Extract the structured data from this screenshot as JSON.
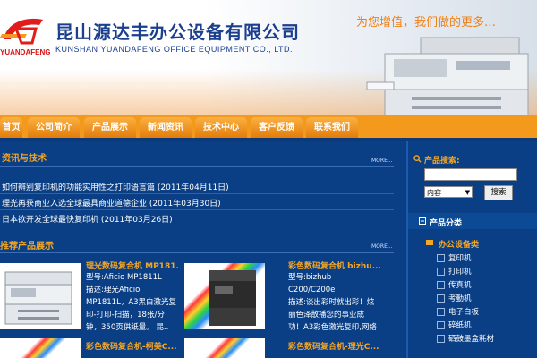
{
  "header": {
    "logo_text": "YUANDAFENG",
    "company_cn": "昆山源达丰办公设备有限公司",
    "company_en": "KUNSHAN YUANDAFENG OFFICE EQUIPMENT CO., LTD.",
    "slogan": "为您增值，我们做的更多…"
  },
  "nav": {
    "items": [
      "首页",
      "公司简介",
      "产品展示",
      "新闻资讯",
      "技术中心",
      "客户反馈",
      "联系我们"
    ]
  },
  "news": {
    "title": "资讯与技术",
    "more": "MORE...",
    "items": [
      "如何辨别复印机的功能实用性之打印语言篇 (2011年04月11日)",
      "理光再获商业入选全球最具商业道德企业 (2011年03月30日)",
      "日本欲开发全球最快复印机 (2011年03月26日)"
    ]
  },
  "products": {
    "title": "推荐产品展示",
    "more": "MORE...",
    "items": [
      {
        "name": "理光数码复合机 MP181...",
        "lines": [
          "型号:Aficio MP1811L",
          "描述:理光Aficio",
          "MP1811L，A3黑白激光复",
          "印-打印-扫描，18张/分",
          "钟，350页供纸量。 昆.."
        ]
      },
      {
        "name": "彩色数码复合机 bizhu...",
        "lines": [
          "型号:bizhub",
          "C200/C200e",
          "描述:谈出彩时就出彩！炫",
          "丽色泽散播您的事业成",
          "功！A3彩色激光复印,网络"
        ]
      },
      {
        "name": "彩色数码复合机-柯美C..."
      },
      {
        "name": "彩色数码复合机-理光C..."
      }
    ]
  },
  "sidebar": {
    "search_label": "产品搜索:",
    "search_placeholder": "",
    "select_value": "内容",
    "search_button": "搜索",
    "category_title": "产品分类",
    "category_main": "办公设备类",
    "categories": [
      "复印机",
      "打印机",
      "传真机",
      "考勤机",
      "电子白板",
      "碎纸机",
      "硒鼓墨盒耗材"
    ]
  },
  "colors": {
    "brand_blue": "#1a3f8f",
    "nav_orange": "#f39a1c",
    "accent_orange": "#f5a623",
    "page_blue": "#0b3f85"
  }
}
